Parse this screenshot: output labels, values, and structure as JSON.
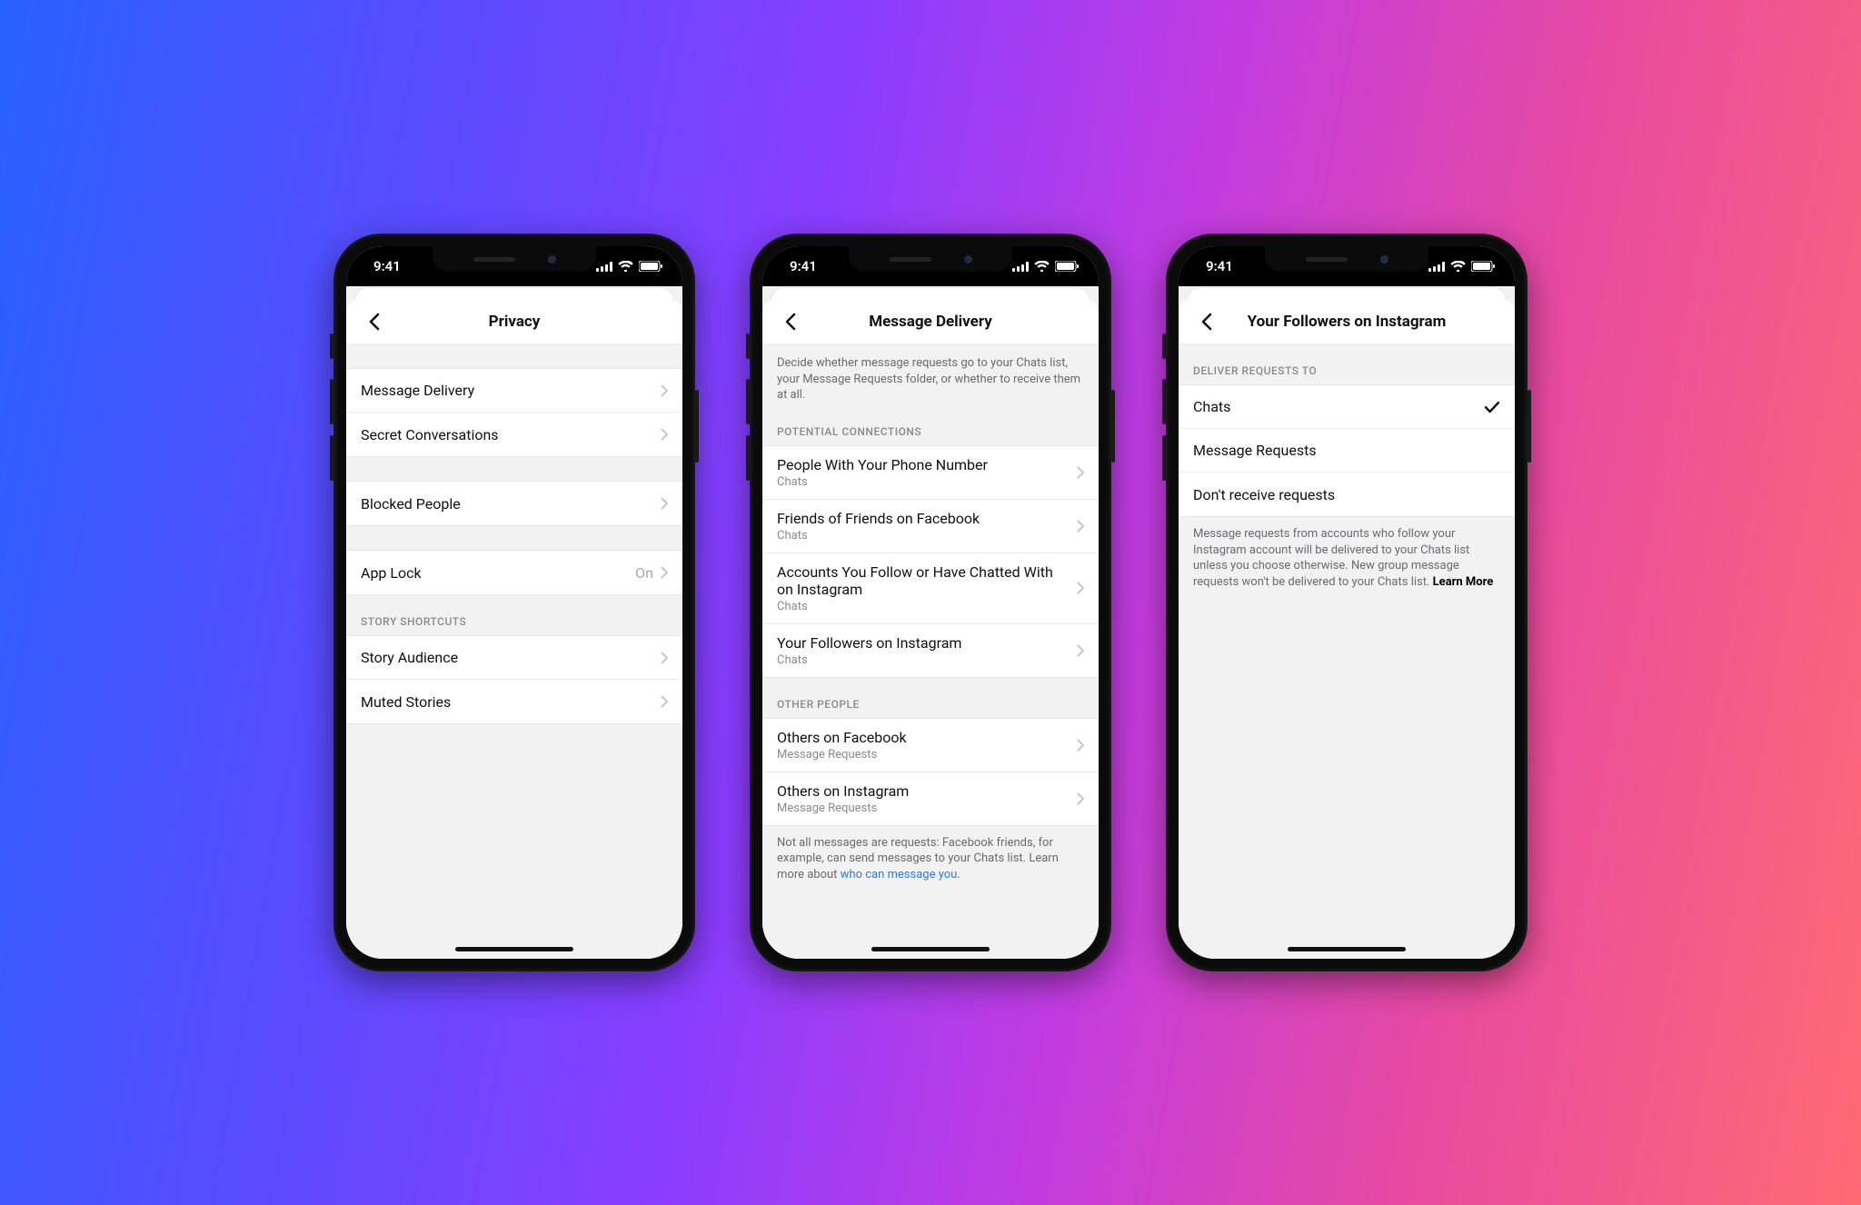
{
  "status": {
    "time": "9:41"
  },
  "phone1": {
    "title": "Privacy",
    "group1": [
      {
        "label": "Message Delivery"
      },
      {
        "label": "Secret Conversations"
      }
    ],
    "group2": [
      {
        "label": "Blocked People"
      }
    ],
    "group3": [
      {
        "label": "App Lock",
        "value": "On"
      }
    ],
    "section_story": "Story Shortcuts",
    "group4": [
      {
        "label": "Story Audience"
      },
      {
        "label": "Muted Stories"
      }
    ]
  },
  "phone2": {
    "title": "Message Delivery",
    "intro": "Decide whether message requests go to your Chats list, your Message Requests folder, or whether to receive them at all.",
    "section_potential": "Potential Connections",
    "potential": [
      {
        "label": "People With Your Phone Number",
        "sub": "Chats"
      },
      {
        "label": "Friends of Friends on Facebook",
        "sub": "Chats"
      },
      {
        "label": "Accounts You Follow or Have Chatted With on Instagram",
        "sub": "Chats"
      },
      {
        "label": "Your Followers on Instagram",
        "sub": "Chats"
      }
    ],
    "section_other": "Other People",
    "other": [
      {
        "label": "Others on Facebook",
        "sub": "Message Requests"
      },
      {
        "label": "Others on Instagram",
        "sub": "Message Requests"
      }
    ],
    "footer_pre": "Not all messages are requests: Facebook friends, for example, can send messages to your Chats list. Learn more about ",
    "footer_link": "who can message you",
    "footer_post": "."
  },
  "phone3": {
    "title": "Your Followers on Instagram",
    "section": "Deliver Requests To",
    "options": [
      {
        "label": "Chats",
        "selected": true
      },
      {
        "label": "Message Requests",
        "selected": false
      },
      {
        "label": "Don't receive requests",
        "selected": false
      }
    ],
    "footer": "Message requests from accounts who follow your Instagram account will be delivered to your Chats list unless you choose otherwise. New group message requests won't be delivered to your Chats list. ",
    "learn_more": "Learn More"
  }
}
